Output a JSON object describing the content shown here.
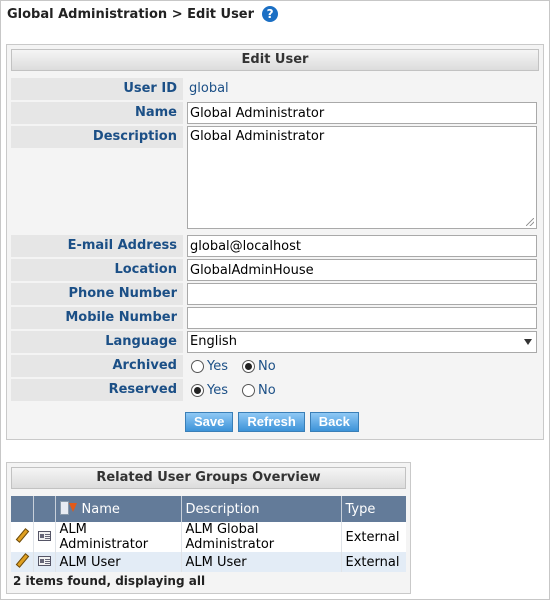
{
  "breadcrumb": {
    "text": "Global Administration > Edit User",
    "help": "?"
  },
  "edit_user": {
    "title": "Edit User",
    "fields": {
      "user_id": {
        "label": "User ID",
        "value": "global"
      },
      "name": {
        "label": "Name",
        "value": "Global Administrator"
      },
      "description": {
        "label": "Description",
        "value": "Global Administrator"
      },
      "email": {
        "label": "E-mail Address",
        "value": "global@localhost"
      },
      "location": {
        "label": "Location",
        "value": "GlobalAdminHouse"
      },
      "phone": {
        "label": "Phone Number",
        "value": ""
      },
      "mobile": {
        "label": "Mobile Number",
        "value": ""
      },
      "language": {
        "label": "Language",
        "value": "English"
      },
      "archived": {
        "label": "Archived",
        "yes": "Yes",
        "no": "No",
        "selected": "No"
      },
      "reserved": {
        "label": "Reserved",
        "yes": "Yes",
        "no": "No",
        "selected": "Yes"
      }
    },
    "buttons": {
      "save": "Save",
      "refresh": "Refresh",
      "back": "Back"
    }
  },
  "related_groups": {
    "title": "Related User Groups Overview",
    "columns": {
      "name": "Name",
      "description": "Description",
      "type": "Type"
    },
    "rows": [
      {
        "name": "ALM Administrator",
        "description": "ALM Global Administrator",
        "type": "External"
      },
      {
        "name": "ALM User",
        "description": "ALM User",
        "type": "External"
      }
    ],
    "footer": "2 items found, displaying all"
  },
  "colors": {
    "label_text": "#1b4f86",
    "button": "#3d93d8",
    "table_header": "#637b99",
    "help_icon": "#1b6fc4"
  }
}
